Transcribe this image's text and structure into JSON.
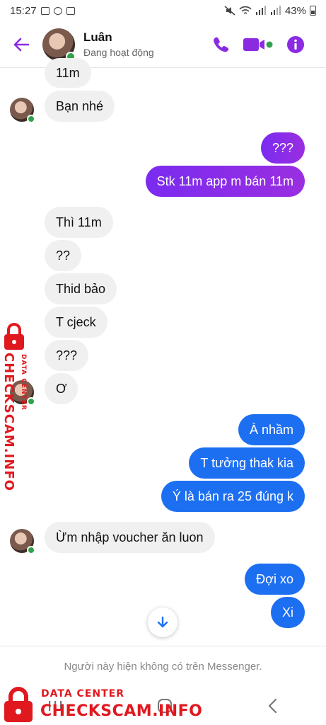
{
  "status_bar": {
    "time": "15:27",
    "battery": "43%"
  },
  "header": {
    "name": "Luân",
    "status": "Đang hoạt động"
  },
  "messages": [
    {
      "side": "in",
      "text": "11m"
    },
    {
      "side": "in",
      "text": "Bạn nhé"
    },
    {
      "side": "out",
      "color": "#8a2be2",
      "text": "???"
    },
    {
      "side": "out",
      "color": "#8a2be2",
      "text": "Stk 11m app m bán 11m"
    },
    {
      "side": "in",
      "text": "Thì 11m"
    },
    {
      "side": "in",
      "text": "??"
    },
    {
      "side": "in",
      "text": "Thid bảo"
    },
    {
      "side": "in",
      "text": "T cjeck"
    },
    {
      "side": "in",
      "text": "???"
    },
    {
      "side": "in",
      "text": "Ơ"
    },
    {
      "side": "out",
      "color": "#1d6ff2",
      "text": "À nhầm"
    },
    {
      "side": "out",
      "color": "#1d6ff2",
      "text": "T tưởng thak kia"
    },
    {
      "side": "out",
      "color": "#1d6ff2",
      "text": "Ý là bán ra 25 đúng k"
    },
    {
      "side": "in",
      "text": "Ừm nhập voucher ăn luon"
    },
    {
      "side": "out",
      "color": "#1d6ff2",
      "text": "Đợi xo"
    },
    {
      "side": "out",
      "color": "#1d6ff2",
      "text": "Xi"
    }
  ],
  "footer_notice": "Người này hiện không có trên Messenger.",
  "watermark": {
    "line1": "DATA CENTER",
    "line2": "CHECKSCAM.INFO"
  },
  "colors": {
    "accent": "#8a2be2",
    "messenger_blue": "#1d6ff2",
    "online": "#31a24c",
    "watermark_red": "#e0191f"
  },
  "icons": [
    "back-arrow-icon",
    "phone-icon",
    "video-camera-icon",
    "info-icon",
    "chevron-down-icon",
    "recent-apps-icon",
    "home-icon",
    "back-nav-icon",
    "padlock-icon"
  ]
}
